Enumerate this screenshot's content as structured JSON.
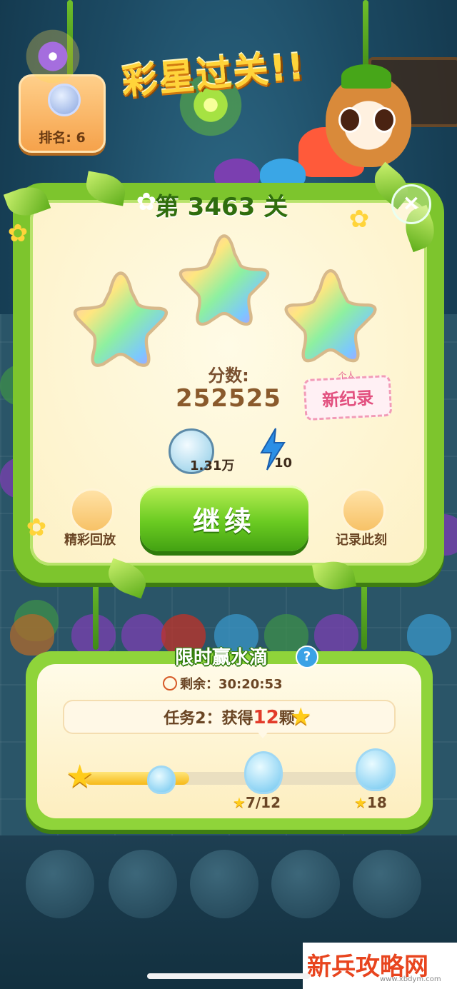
{
  "game": {
    "title_banner": "彩星过关!!",
    "rank_label": "排名: 6",
    "level_label": "第 3463 关",
    "close_symbol": "×",
    "stars_earned": 3,
    "score_label": "分数:",
    "score_value": "252525",
    "record_badge_top": "个人",
    "record_badge_main": "新纪录",
    "rewards": {
      "coin_value": "1.31万",
      "energy_value": "10"
    },
    "continue_label": "继续",
    "replay_label": "精彩回放",
    "snapshot_label": "记录此刻",
    "icons": {
      "rank": "medal-icon",
      "close": "close-icon",
      "coin": "leaf-coin-icon",
      "energy": "lightning-icon",
      "replay": "video-camera-icon",
      "snapshot": "camera-icon",
      "help": "question-icon",
      "clock": "clock-icon",
      "star": "star-icon",
      "bottle": "water-bottle-icon"
    },
    "colors": {
      "panel_green": "#7dc52d",
      "button_green": "#6bcb22",
      "star_gold": "#ffcc1a",
      "record_pink": "#e2507f"
    }
  },
  "event": {
    "title": "限时赢水滴",
    "help_symbol": "?",
    "timer_prefix": "剩余：",
    "timer_value": "30:20:53",
    "task_prefix": "任务2：获得",
    "task_count": "12",
    "task_suffix": "颗",
    "progress": 0.35,
    "milestone_1_label": "7/12",
    "milestone_2_label": "18",
    "star_glyph": "★"
  },
  "watermark": {
    "main": "新兵攻略网",
    "sub": "www.xbdym.com"
  }
}
